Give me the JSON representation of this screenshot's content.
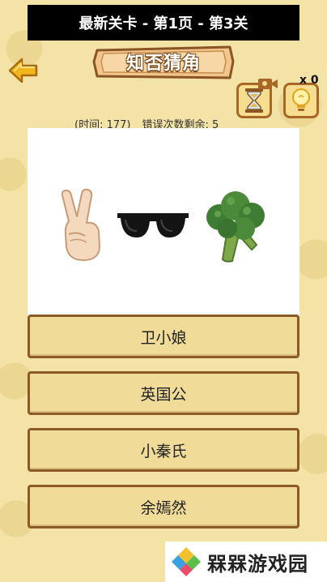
{
  "header": {
    "level_title": "最新关卡 - 第1页 - 第3关",
    "game_title": "知否猜角"
  },
  "hints": {
    "bulb_count": "x 0"
  },
  "stats": {
    "time_label": "(时间: 177)",
    "errors_label": "错误次数剩余: 5"
  },
  "puzzle": {
    "emojis": [
      "victory-hand",
      "sunglasses",
      "broccoli"
    ]
  },
  "options": [
    {
      "label": "卫小娘"
    },
    {
      "label": "英国公"
    },
    {
      "label": "小秦氏"
    },
    {
      "label": "余嫣然"
    }
  ],
  "watermark": {
    "text": "槑槑游戏园"
  },
  "colors": {
    "background": "#f3e3a6",
    "option_fill": "#f0dc98",
    "option_border": "#8c5a26",
    "banner": "#f2c58c",
    "accent_arrow": "#f2b51b"
  }
}
